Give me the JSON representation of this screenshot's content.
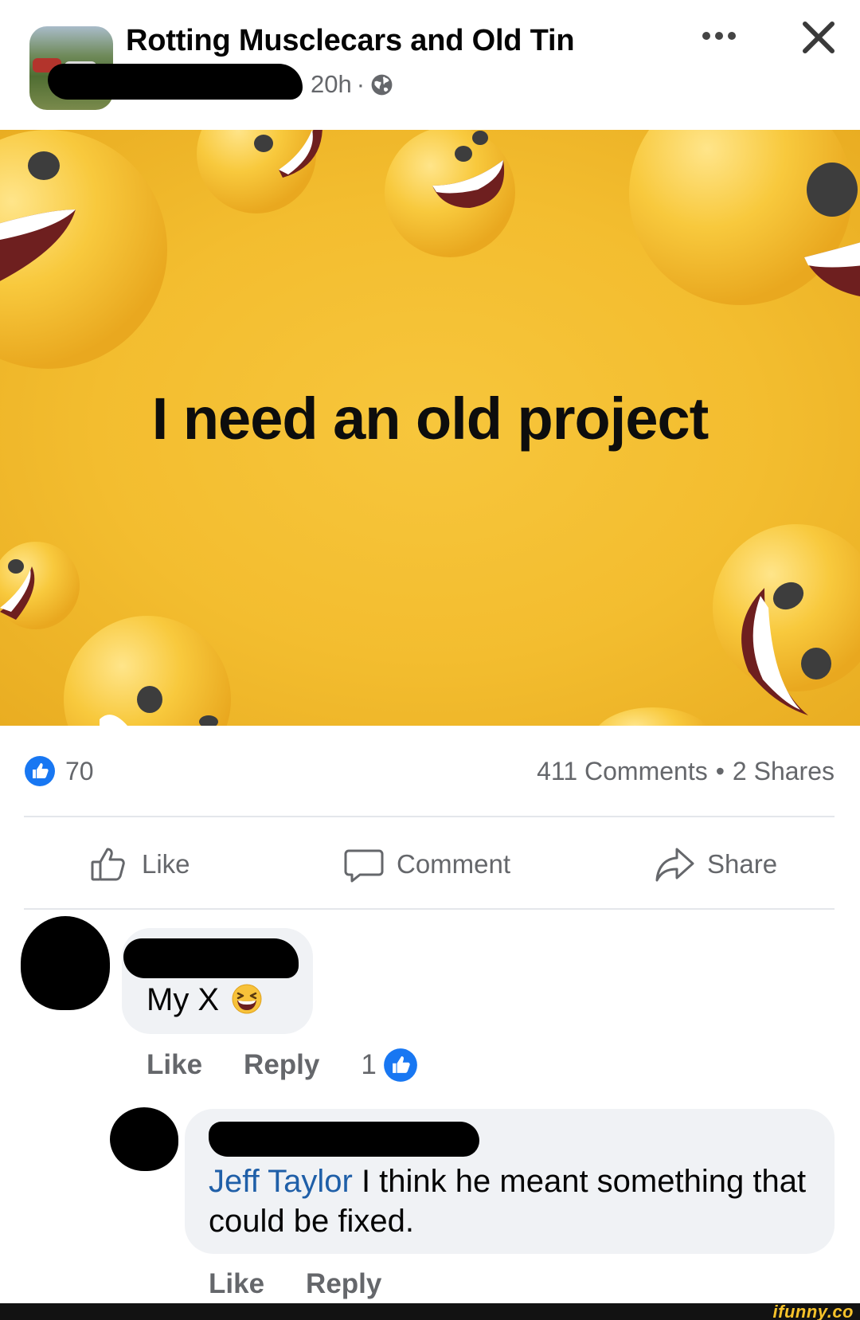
{
  "header": {
    "group_title": "Rotting Musclecars and Old Tin",
    "time": "20h",
    "separator": "·",
    "privacy_icon": "globe-icon",
    "more_icon": "more-dots-icon",
    "close_icon": "close-x-icon"
  },
  "post": {
    "text": "I need an old project",
    "background_color": "#f4bf30"
  },
  "stats": {
    "reaction_count": "70",
    "comments": "411 Comments",
    "dot": "•",
    "shares": "2 Shares"
  },
  "actions": {
    "like": "Like",
    "comment": "Comment",
    "share": "Share"
  },
  "comments": [
    {
      "text": "My X",
      "emoji": "grinning-squinting-face-icon",
      "like": "Like",
      "reply": "Reply",
      "reaction_count": "1"
    },
    {
      "mention": "Jeff Taylor",
      "text": " I think he meant something that could be fixed.",
      "like": "Like",
      "reply": "Reply"
    }
  ],
  "watermark": "ifunny.co",
  "colors": {
    "accent": "#1877f2",
    "muted": "#65676b",
    "mention": "#1f5fa8",
    "bubble": "#f0f2f5"
  }
}
